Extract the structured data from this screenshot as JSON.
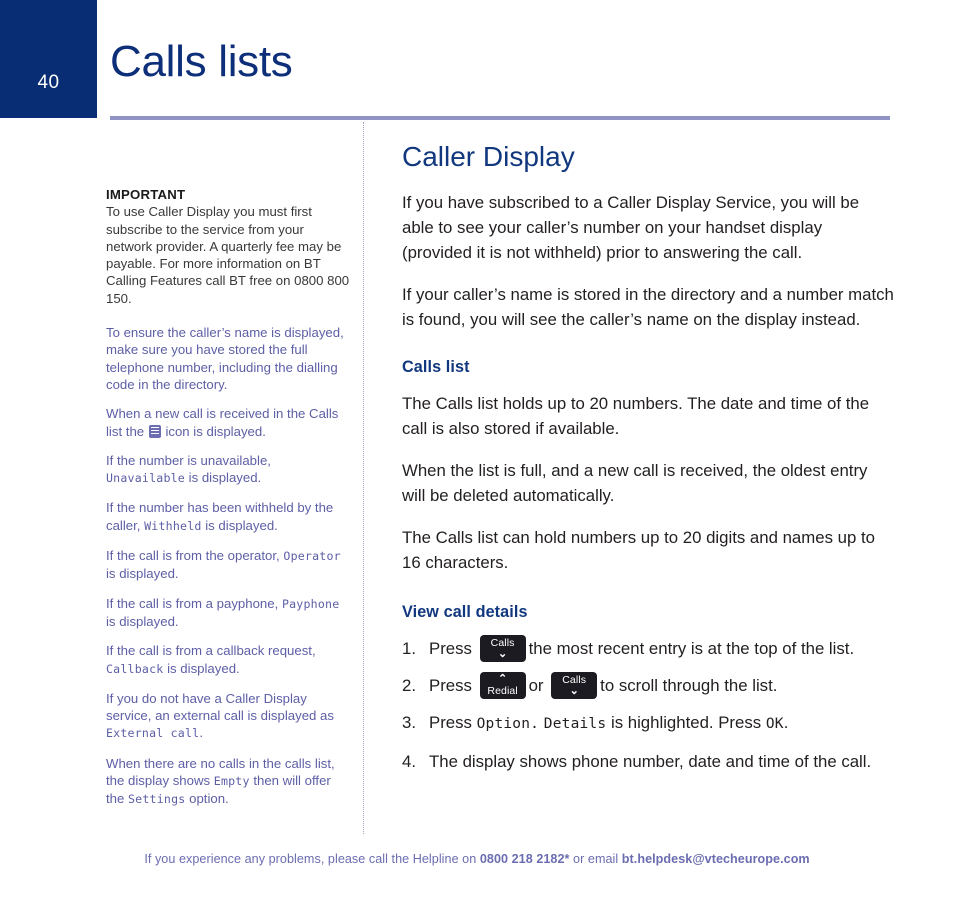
{
  "header": {
    "page_number": "40",
    "title": "Calls lists",
    "accent_navy": "#092d74",
    "rule_color": "#9193c4"
  },
  "sidebar": {
    "important_heading": "IMPORTANT",
    "important_text": "To use Caller Display you must first subscribe to the service from your network provider.  A quarterly fee may be payable.  For more information on BT Calling Features call BT free on 0800 800 150.",
    "notes": [
      {
        "id": "note-directory",
        "text_before": "To ensure the caller’s name is displayed, make sure you have stored the full telephone number, including the dialling code in the directory.",
        "lcd": "",
        "text_after": ""
      },
      {
        "id": "note-new-call-icon",
        "text_before": "When a new call is received in the Calls list the ",
        "lcd": "",
        "text_after": " icon is displayed."
      },
      {
        "id": "note-unavailable",
        "text_before": "If the number is unavailable, ",
        "lcd": "Unavailable",
        "text_after": " is displayed."
      },
      {
        "id": "note-withheld",
        "text_before": "If the number has been withheld by the caller, ",
        "lcd": "Withheld",
        "text_after": " is displayed."
      },
      {
        "id": "note-operator",
        "text_before": "If the call is from the operator, ",
        "lcd": "Operator",
        "text_after": " is displayed."
      },
      {
        "id": "note-payphone",
        "text_before": "If the call is from a payphone, ",
        "lcd": "Payphone",
        "text_after": " is displayed."
      },
      {
        "id": "note-callback",
        "text_before": "If the call is from a callback request, ",
        "lcd": "Callback",
        "text_after": " is displayed."
      },
      {
        "id": "note-external",
        "text_before": "If you do not have a Caller Display service, an external call is displayed as ",
        "lcd": "External call",
        "text_after": "."
      }
    ],
    "empty_note": {
      "part1": "When there are no calls in the calls list, the display shows ",
      "lcd1": "Empty",
      "part2": " then will offer the ",
      "lcd2": "Settings",
      "part3": " option."
    },
    "note_color": "#5d5fa6"
  },
  "main": {
    "heading": "Caller Display",
    "paragraphs": [
      "If you have subscribed to a Caller Display Service, you will be able to see your caller’s number on your handset display (provided it is not withheld) prior to answering the call.",
      "If your caller’s name is stored in the directory and a number match is found, you will see the caller’s name on the display instead."
    ],
    "calls_list_heading": "Calls list",
    "calls_list_paragraphs": [
      "The Calls list holds up to 20 numbers. The date and time of the call is also stored if available.",
      "When the list is full, and a new call is received, the oldest entry will be deleted automatically.",
      "The Calls list can hold numbers up to 20 digits and names up to 16 characters."
    ],
    "view_call_details_heading": "View call details",
    "steps": [
      {
        "num": "1.",
        "before": "Press",
        "key1": {
          "label": "Calls",
          "chevron": "⌄",
          "position": "below"
        },
        "middle": "",
        "key2": null,
        "after": "the most recent entry is at the top of the list."
      },
      {
        "num": "2.",
        "before": "Press",
        "key1": {
          "label": "Redial",
          "chevron": "⌃",
          "position": "above"
        },
        "middle": "or",
        "key2": {
          "label": "Calls",
          "chevron": "⌄",
          "position": "below"
        },
        "after": "to scroll through the list."
      },
      {
        "num": "3.",
        "before": "Press",
        "lcd1": "Option",
        "middle1": ".",
        "lcd2": "Details",
        "middle2": " is highlighted. Press ",
        "lcd3": "OK",
        "after": "."
      },
      {
        "num": "4.",
        "text": "The display shows phone number, date and time of the call."
      }
    ],
    "heading_color": "#11387f"
  },
  "footer": {
    "text_before": "If you experience any problems, please call the Helpline on ",
    "phone": "0800 218 2182*",
    "text_middle": " or email ",
    "email": "bt.helpdesk@vtecheurope.com",
    "color": "#6b6db0"
  }
}
